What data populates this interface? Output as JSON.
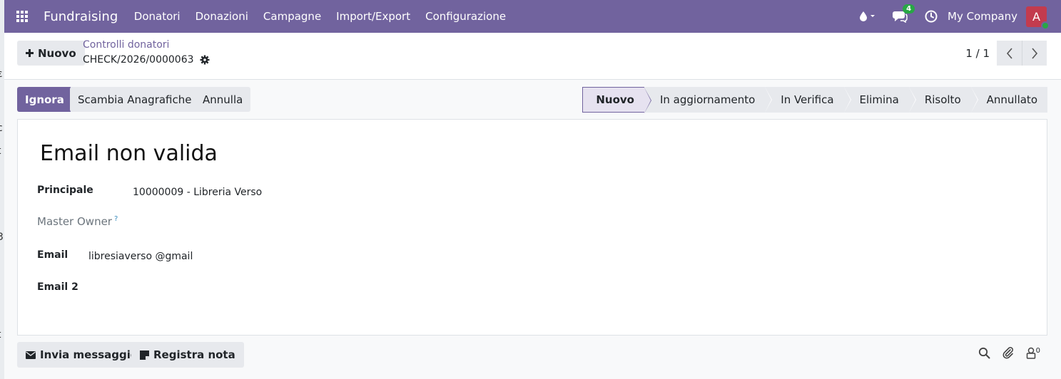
{
  "left_edge": [
    "ε",
    "c",
    "t",
    "3",
    "t"
  ],
  "navbar": {
    "brand": "Fundraising",
    "menu": [
      "Donatori",
      "Donazioni",
      "Campagne",
      "Import/Export",
      "Configurazione"
    ],
    "messages_badge": "4",
    "company": "My Company",
    "avatar_letter": "A",
    "colors": {
      "navbar_bg": "#71639e",
      "avatar_bg": "#c33b4e",
      "online": "#28a745"
    }
  },
  "control": {
    "new_button": "Nuovo",
    "breadcrumb_parent": "Controlli donatori",
    "breadcrumb_current": "CHECK/2026/0000063",
    "pager": "1 / 1"
  },
  "actions": {
    "ignore": "Ignora",
    "swap": "Scambia Anagrafiche",
    "cancel": "Annulla"
  },
  "stages": [
    {
      "label": "Nuovo",
      "active": true
    },
    {
      "label": "In aggiornamento",
      "active": false
    },
    {
      "label": "In Verifica",
      "active": false
    },
    {
      "label": "Elimina",
      "active": false
    },
    {
      "label": "Risolto",
      "active": false
    },
    {
      "label": "Annullato",
      "active": false
    }
  ],
  "form": {
    "title": "Email non valida",
    "principal_label": "Principale",
    "principal_value": "10000009 - Libreria Verso",
    "master_owner_label": "Master Owner",
    "master_owner_help": "?",
    "email_label": "Email",
    "email_value": "libresiaverso @gmail",
    "email2_label": "Email 2"
  },
  "chatter": {
    "send_message": "Invia messaggio",
    "log_note": "Registra nota",
    "followers_count": "0"
  }
}
